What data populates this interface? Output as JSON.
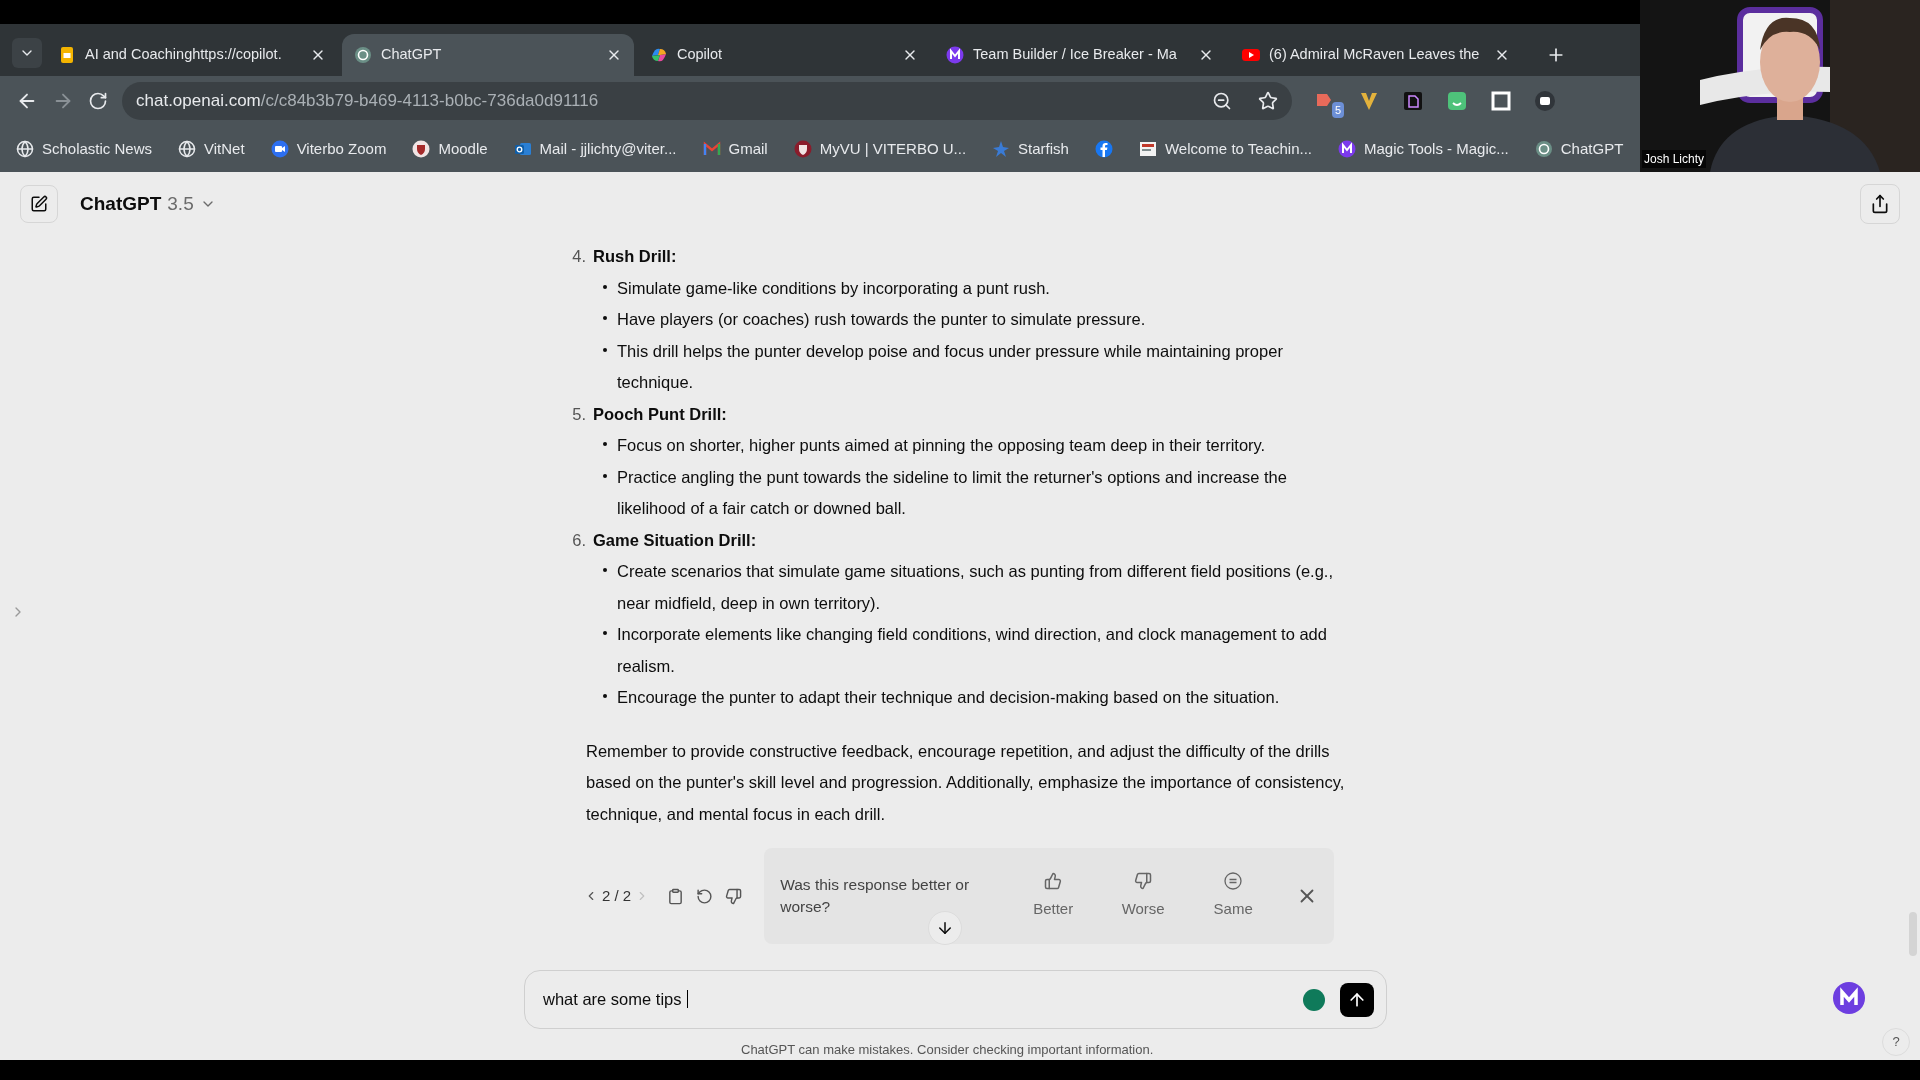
{
  "browser": {
    "tabs": [
      {
        "title": "AI and Coachinghttps://copilot.",
        "selected": false
      },
      {
        "title": "ChatGPT",
        "selected": true
      },
      {
        "title": "Copilot",
        "selected": false
      },
      {
        "title": "Team Builder / Ice Breaker - Ma",
        "selected": false
      },
      {
        "title": "(6) Admiral McRaven Leaves the",
        "selected": false
      }
    ],
    "address": {
      "host": "chat.openai.com",
      "path": "/c/c84b3b79-b469-4113-b0bc-736da0d91116"
    },
    "extension_badge": "5",
    "bookmarks": [
      {
        "kind": "labeled",
        "label": "Scholastic News"
      },
      {
        "kind": "labeled",
        "label": "VitNet"
      },
      {
        "kind": "labeled",
        "label": "Viterbo Zoom"
      },
      {
        "kind": "labeled",
        "label": "Moodle"
      },
      {
        "kind": "labeled",
        "label": "Mail - jjlichty@viter..."
      },
      {
        "kind": "labeled",
        "label": "Gmail"
      },
      {
        "kind": "labeled",
        "label": "MyVU | VITERBO U..."
      },
      {
        "kind": "labeled",
        "label": "Starfish"
      },
      {
        "kind": "icon"
      },
      {
        "kind": "labeled",
        "label": "Welcome to Teachin..."
      },
      {
        "kind": "labeled",
        "label": "Magic Tools - Magic..."
      },
      {
        "kind": "labeled",
        "label": "ChatGPT"
      }
    ]
  },
  "webcam": {
    "name": "Josh Lichty"
  },
  "chat": {
    "model": "ChatGPT",
    "version": "3.5",
    "items": [
      {
        "number": "4.",
        "title": "Rush Drill:",
        "bullets": [
          "Simulate game-like conditions by incorporating a punt rush.",
          "Have players (or coaches) rush towards the punter to simulate pressure.",
          "This drill helps the punter develop poise and focus under pressure while maintaining proper technique."
        ]
      },
      {
        "number": "5.",
        "title": "Pooch Punt Drill:",
        "bullets": [
          "Focus on shorter, higher punts aimed at pinning the opposing team deep in their territory.",
          "Practice angling the punt towards the sideline to limit the returner's options and increase the likelihood of a fair catch or downed ball."
        ]
      },
      {
        "number": "6.",
        "title": "Game Situation Drill:",
        "bullets": [
          "Create scenarios that simulate game situations, such as punting from different field positions (e.g., near midfield, deep in own territory).",
          "Incorporate elements like changing field conditions, wind direction, and clock management to add realism.",
          "Encourage the punter to adapt their technique and decision-making based on the situation."
        ]
      }
    ],
    "closing": "Remember to provide constructive feedback, encourage repetition, and adjust the difficulty of the drills based on the punter's skill level and progression. Additionally, emphasize the importance of consistency, technique, and mental focus in each drill.",
    "pager": {
      "text": "2 / 2",
      "prev_disabled": false,
      "next_disabled": true
    },
    "feedback": {
      "question": "Was this response better or worse?",
      "options": [
        {
          "label": "Better"
        },
        {
          "label": "Worse"
        },
        {
          "label": "Same"
        }
      ]
    },
    "input": {
      "value": "what are some tips "
    },
    "disclaimer": "ChatGPT can make mistakes. Consider checking important information.",
    "help": "?"
  }
}
